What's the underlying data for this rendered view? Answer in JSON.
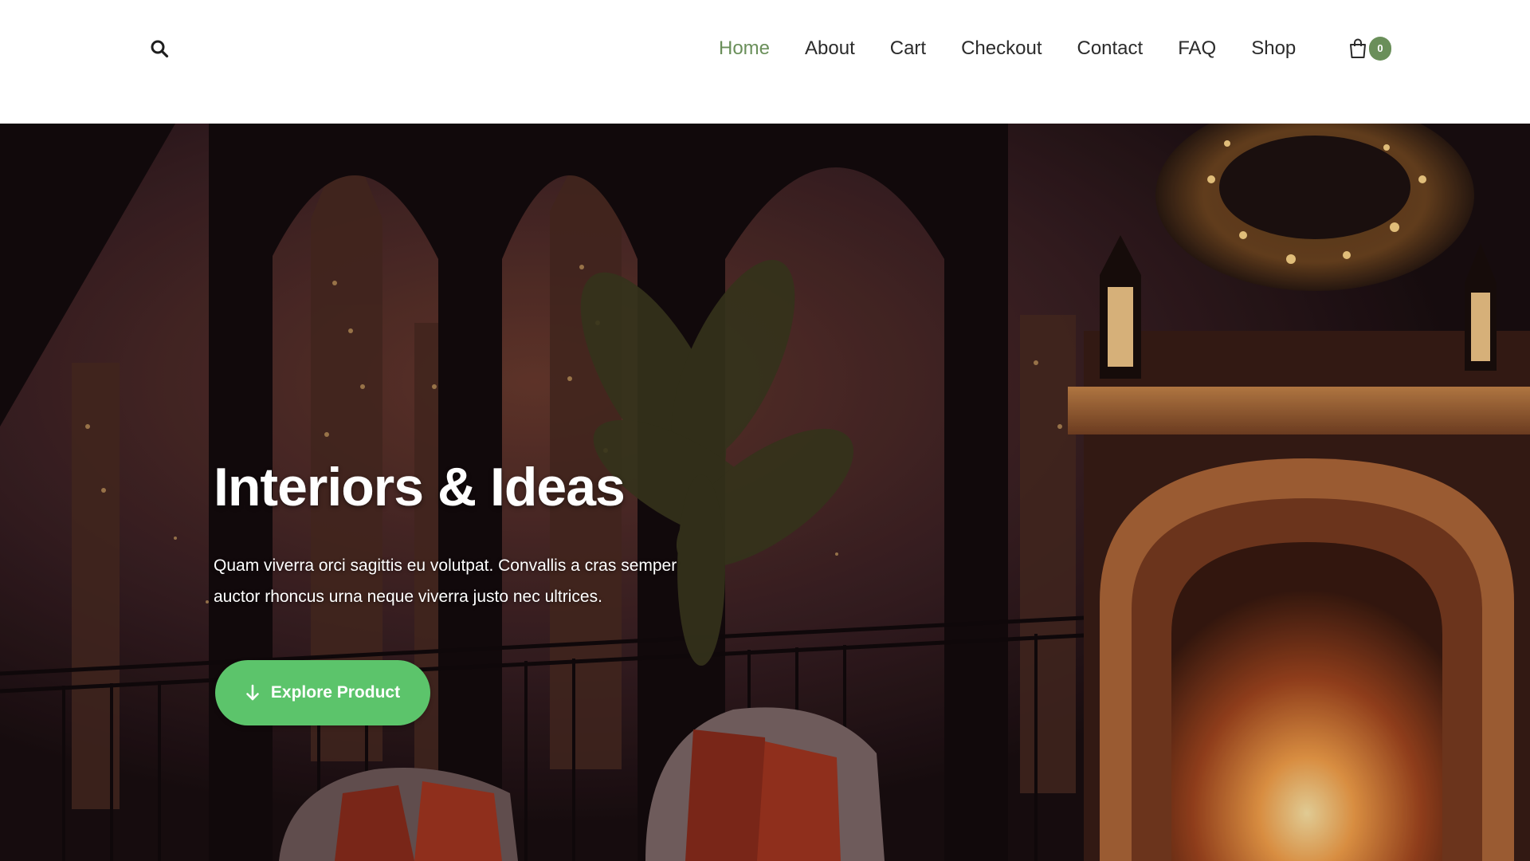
{
  "header": {
    "search_icon": "search-icon",
    "nav": [
      {
        "label": "Home",
        "active": true
      },
      {
        "label": "About"
      },
      {
        "label": "Cart"
      },
      {
        "label": "Checkout"
      },
      {
        "label": "Contact"
      },
      {
        "label": "FAQ"
      },
      {
        "label": "Shop"
      }
    ],
    "cart": {
      "icon": "shopping-bag-icon",
      "count": "0"
    }
  },
  "hero": {
    "title": "Interiors & Ideas",
    "text": "Quam viverra orci sagittis eu volutpat. Convallis a cras semper auctor rhoncus urna neque viverra justo nec ultrices.",
    "button": {
      "icon": "arrow-down-icon",
      "label": "Explore Product"
    }
  },
  "colors": {
    "accent": "#6a8f5a",
    "button": "#5cc46b",
    "nav_text": "#2b2b2b"
  }
}
